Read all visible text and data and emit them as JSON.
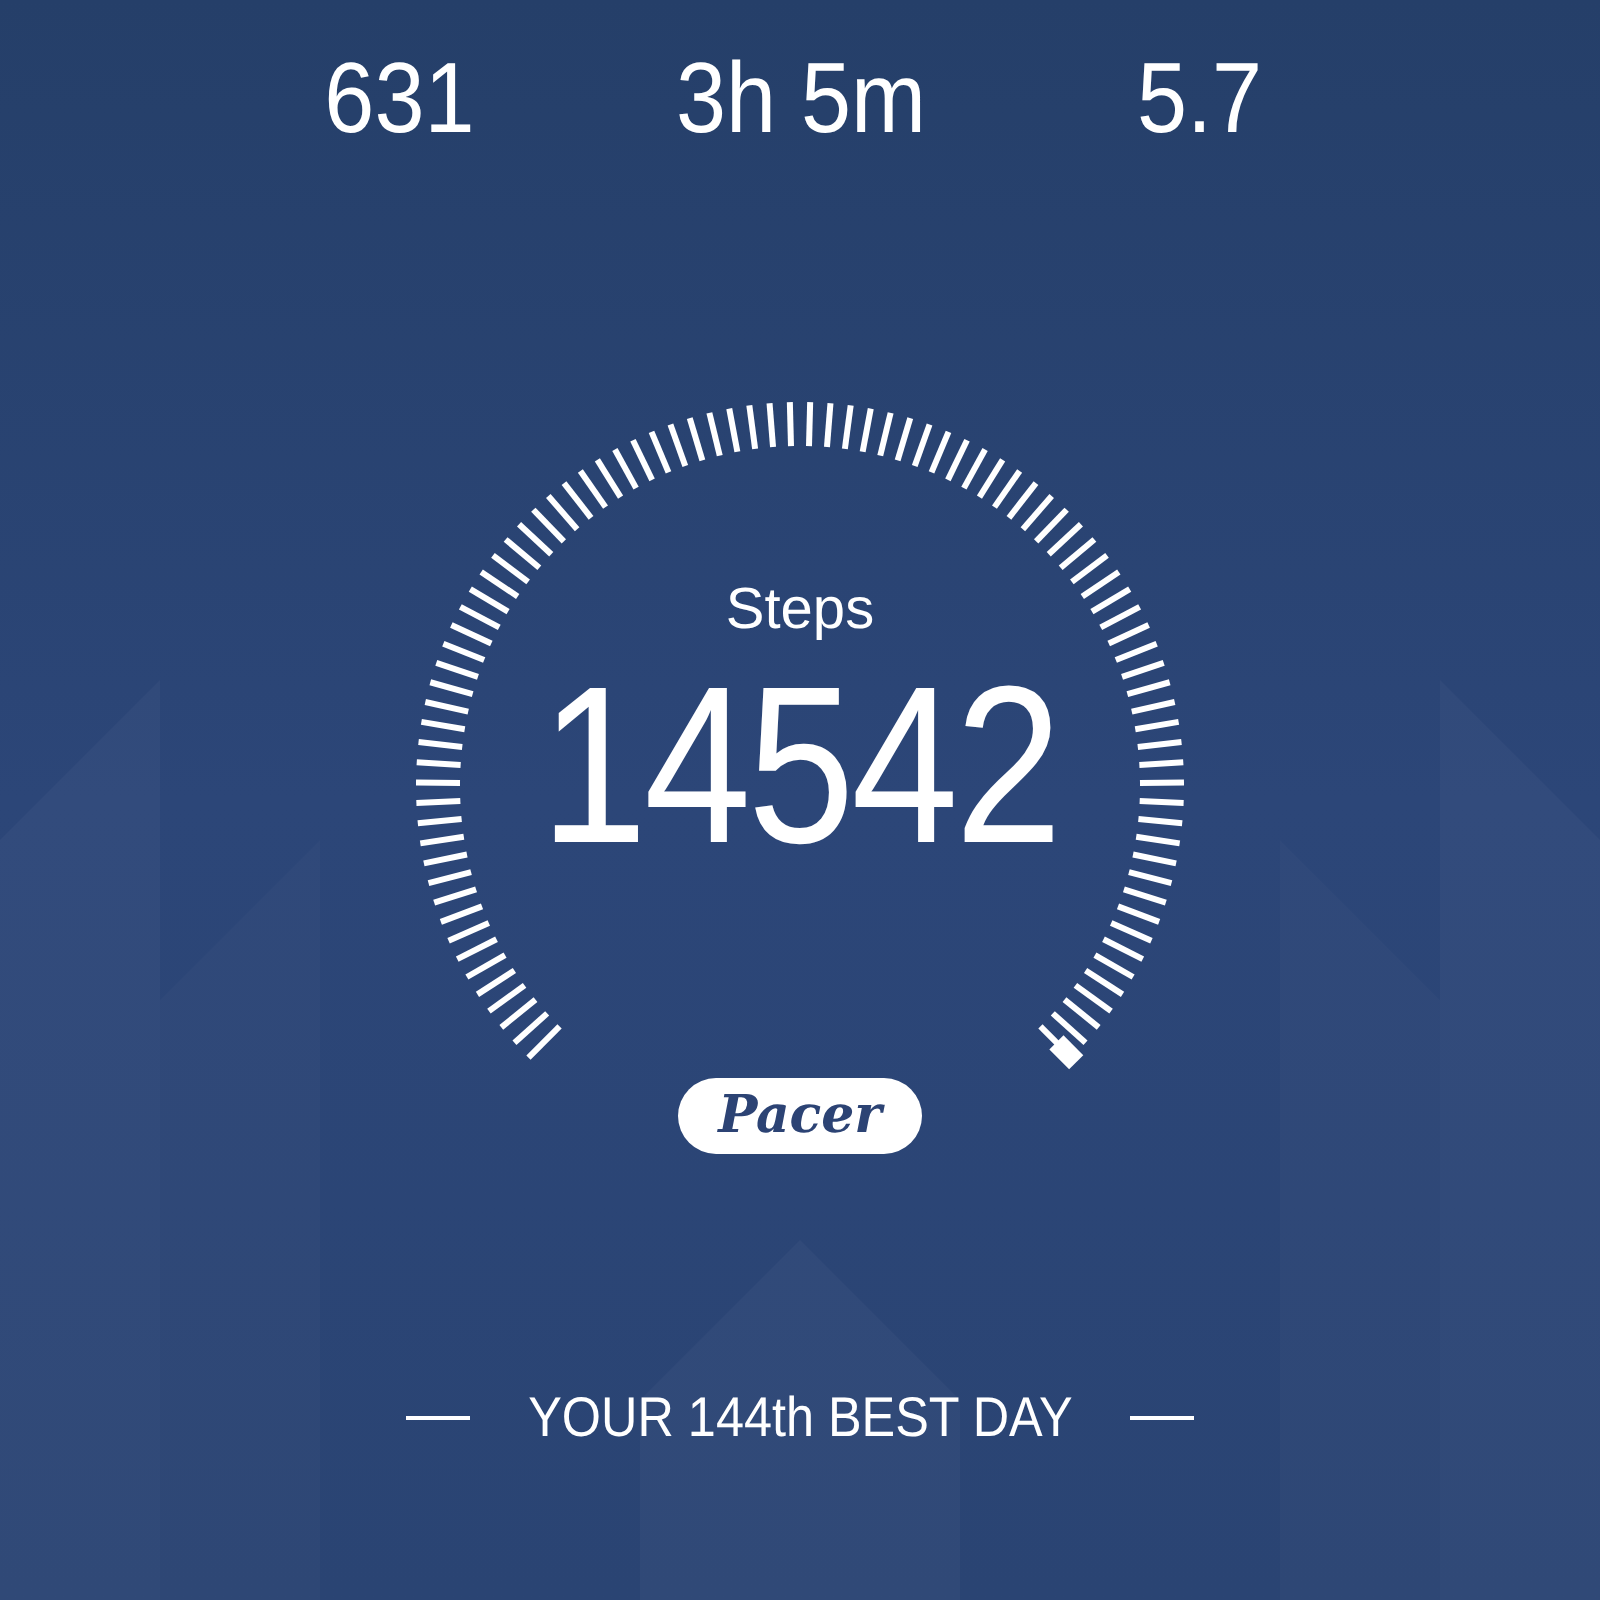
{
  "stats": [
    {
      "value": "631"
    },
    {
      "value": "3h 5m"
    },
    {
      "value": "5.7"
    }
  ],
  "gauge": {
    "label": "Steps",
    "value": "14542"
  },
  "logo": "Pacer",
  "footer": "YOUR 144th BEST DAY"
}
